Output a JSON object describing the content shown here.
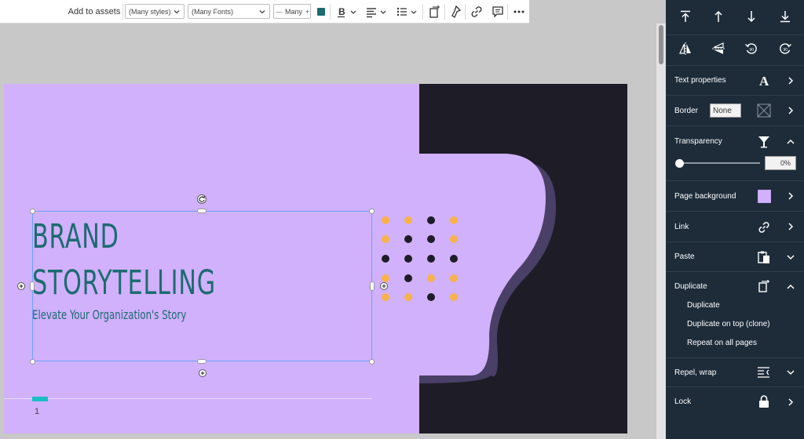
{
  "toolbar": {
    "add_to_assets": "Add to assets",
    "styles_select": "(Many styles)",
    "fonts_select": "(Many Fonts)",
    "size_value": "Many",
    "size_minus": "—",
    "size_plus": "+",
    "text_color": "#1c6b70"
  },
  "slide": {
    "title_line1": "BRAND",
    "title_line2": "STORYTELLING",
    "subtitle": "Elevate Your Organization's Story",
    "page_number": "1",
    "background_color": "#d1b0fc",
    "dark_color": "#1e1d27",
    "accent_color": "#18c0c4"
  },
  "panel": {
    "text_properties": "Text properties",
    "border_label": "Border",
    "border_value": "None",
    "transparency_label": "Transparency",
    "transparency_value": "0%",
    "page_background_label": "Page background",
    "page_background_color": "#d1b0fc",
    "link_label": "Link",
    "paste_label": "Paste",
    "duplicate_label": "Duplicate",
    "duplicate_items": [
      "Duplicate",
      "Duplicate on top (clone)",
      "Repeat on all pages"
    ],
    "repel_wrap_label": "Repel, wrap",
    "lock_label": "Lock"
  }
}
